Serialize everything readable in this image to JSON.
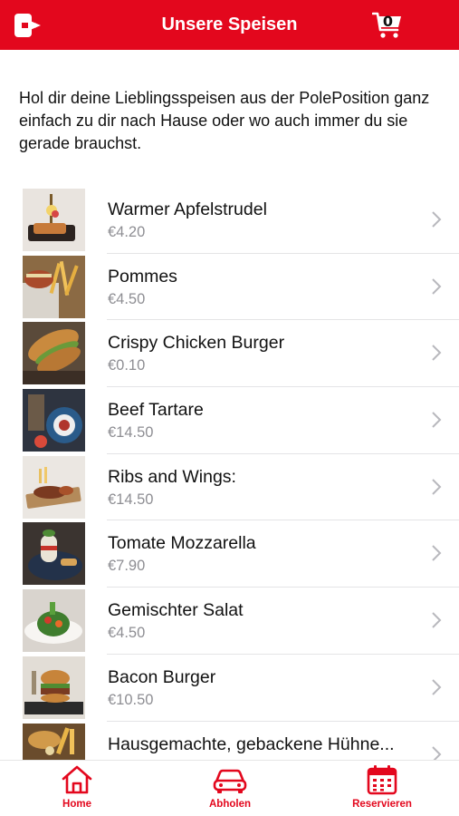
{
  "header": {
    "title": "Unsere Speisen",
    "cart_count": "0",
    "accent_color": "#e3071d",
    "left_icon": "logout-icon",
    "right_icon": "shopping-cart-icon"
  },
  "intro_text": "Hol dir deine Lieblingsspeisen aus der PolePosition ganz einfach zu dir nach Hause oder wo auch immer du sie gerade brauchst.",
  "menu": {
    "items": [
      {
        "name": "Warmer Apfelstrudel",
        "price": "€4.20"
      },
      {
        "name": "Pommes",
        "price": "€4.50"
      },
      {
        "name": "Crispy Chicken Burger",
        "price": "€0.10"
      },
      {
        "name": "Beef Tartare",
        "price": "€14.50"
      },
      {
        "name": "Ribs and Wings:",
        "price": "€14.50"
      },
      {
        "name": "Tomate Mozzarella",
        "price": "€7.90"
      },
      {
        "name": "Gemischter Salat",
        "price": "€4.50"
      },
      {
        "name": "Bacon Burger",
        "price": "€10.50"
      },
      {
        "name": "Hausgemachte, gebackene Hühne...",
        "price": ""
      }
    ]
  },
  "tabbar": {
    "home": {
      "label": "Home",
      "icon": "home-icon"
    },
    "abholen": {
      "label": "Abholen",
      "icon": "car-icon"
    },
    "reservieren": {
      "label": "Reservieren",
      "icon": "calendar-icon"
    }
  }
}
